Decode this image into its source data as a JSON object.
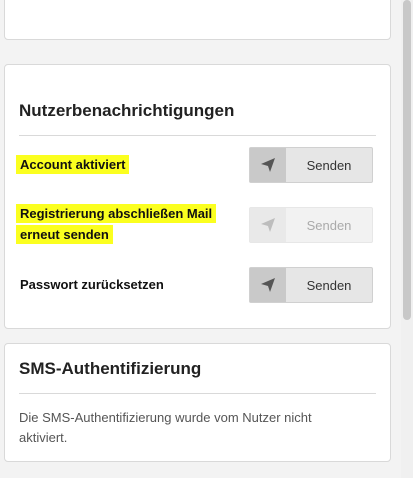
{
  "notifications": {
    "title": "Nutzerbenachrichtigungen",
    "rows": [
      {
        "label": "Account aktiviert",
        "button": "Senden",
        "enabled": true,
        "highlighted": true
      },
      {
        "label": "Registrierung abschließen Mail erneut senden",
        "button": "Senden",
        "enabled": false,
        "highlighted": true
      },
      {
        "label": "Passwort zurücksetzen",
        "button": "Senden",
        "enabled": true,
        "highlighted": false
      }
    ],
    "icon": "paper-plane-icon",
    "highlight_color": "#fbff1f"
  },
  "sms": {
    "title": "SMS-Authentifizierung",
    "text": "Die SMS-Authentifizierung wurde vom Nutzer nicht aktiviert."
  }
}
